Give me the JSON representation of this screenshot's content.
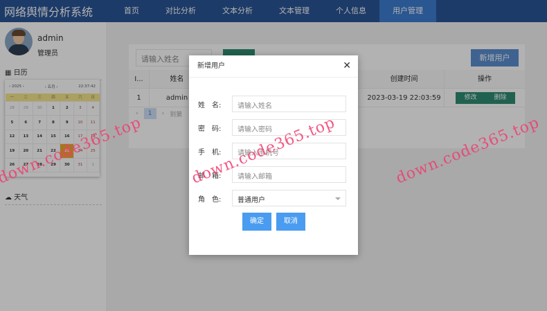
{
  "header": {
    "title": "网络舆情分析系统",
    "nav": [
      "首页",
      "对比分析",
      "文本分析",
      "文本管理",
      "个人信息",
      "用户管理"
    ],
    "active": 5
  },
  "sidebar": {
    "username": "admin",
    "role": "管理员",
    "calendar_label": "日历",
    "weather_label": "天气",
    "calendar": {
      "year": "2025",
      "month": "五月",
      "time": "22:37:42",
      "weekdays": [
        "一",
        "二",
        "三",
        "四",
        "五",
        "六",
        "日"
      ],
      "weeks": [
        [
          "28",
          "29",
          "30",
          "1",
          "2",
          "3",
          "4"
        ],
        [
          "5",
          "6",
          "7",
          "8",
          "9",
          "10",
          "11"
        ],
        [
          "12",
          "13",
          "14",
          "15",
          "16",
          "17",
          "18"
        ],
        [
          "19",
          "20",
          "21",
          "22",
          "23",
          "24",
          "25"
        ],
        [
          "26",
          "27",
          "28",
          "29",
          "30",
          "31",
          "1"
        ]
      ],
      "today": "23"
    }
  },
  "main": {
    "search_placeholder": "请输入姓名",
    "add_button": "新增用户",
    "columns": {
      "id": "I...",
      "name": "姓名",
      "created": "创建时间",
      "ops": "操作"
    },
    "rows": [
      {
        "id": "1",
        "name": "admin",
        "created": "2023-03-19 22:03:59",
        "edit": "修改",
        "delete": "删除"
      }
    ],
    "pager": {
      "page": "1",
      "goto": "到第"
    }
  },
  "modal": {
    "title": "新增用户",
    "fields": [
      {
        "label": "姓　名:",
        "placeholder": "请输入姓名"
      },
      {
        "label": "密　码:",
        "placeholder": "请输入密码"
      },
      {
        "label": "手　机:",
        "placeholder": "请输入手机号"
      },
      {
        "label": "邮　箱:",
        "placeholder": "请输入邮箱"
      },
      {
        "label": "角　色:",
        "value": "普通用户"
      }
    ],
    "confirm": "确定",
    "cancel": "取消"
  },
  "watermark": "down.code365.top"
}
